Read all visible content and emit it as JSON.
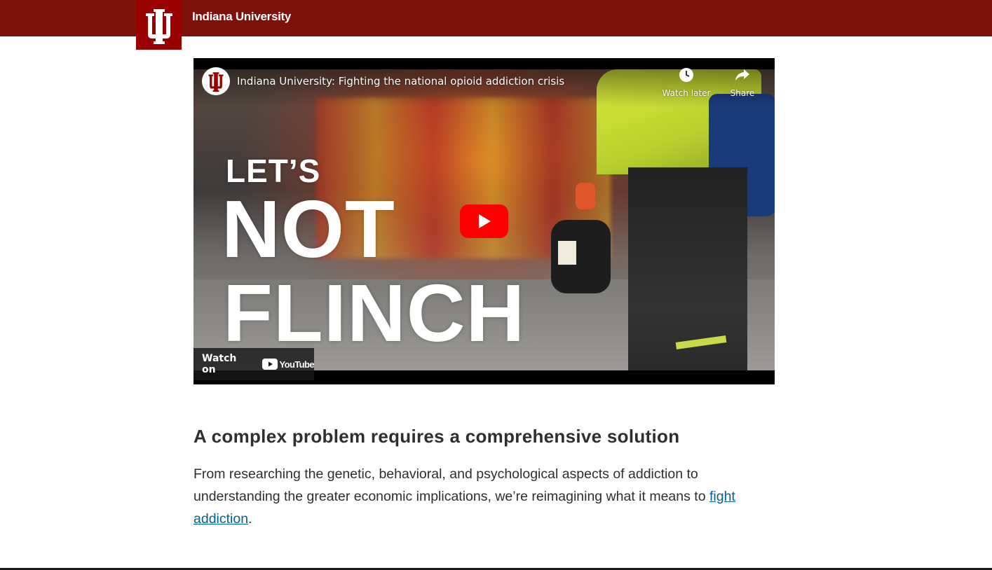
{
  "header": {
    "brand_name": "Indiana University",
    "logo_icon": "iu-trident-icon",
    "colors": {
      "bar": "#7d110c",
      "logo_block": "#990000"
    }
  },
  "video": {
    "title": "Indiana University: Fighting the national opioid addiction crisis",
    "watch_later_label": "Watch later",
    "share_label": "Share",
    "watch_on_label": "Watch on",
    "youtube_label": "YouTube",
    "thumbnail_slogan": [
      "LET’S",
      "NOT",
      "FLINCH"
    ],
    "play_button_color": "#ff0000"
  },
  "article": {
    "heading": "A complex problem requires a comprehensive solution",
    "paragraph_text": "From researching the genetic, behavioral, and psychological aspects of addiction to understanding the greater economic implications, we’re reimagining what it means to ",
    "link_text": "fight addiction",
    "paragraph_end": ".",
    "link_color": "#006298"
  }
}
